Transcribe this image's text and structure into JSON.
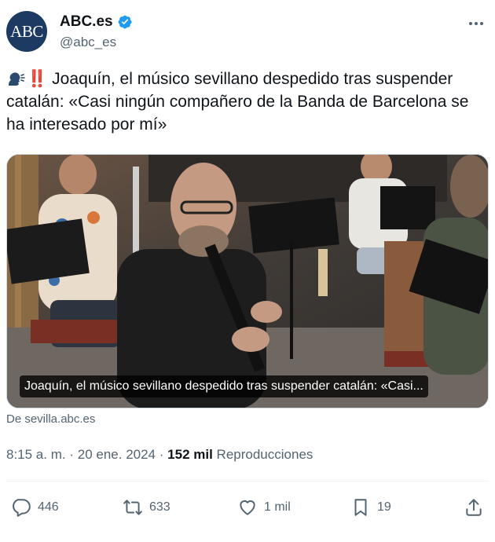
{
  "account": {
    "avatar_text": "ABC",
    "display_name": "ABC.es",
    "handle": "@abc_es",
    "verified": true,
    "avatar_color": "#1d3a63",
    "verified_color": "#1d9bf0"
  },
  "tweet": {
    "emoji_speaking": "speaking-head-emoji",
    "emoji_exclamation": "‼️",
    "text": "Joaquín, el músico sevillano despedido tras suspender catalán: «Casi ningún compañero de la Banda de Barcelona se ha interesado por mí»"
  },
  "media": {
    "caption": "Joaquín, el músico sevillano despedido tras suspender catalán: «Casi...",
    "source": "De sevilla.abc.es"
  },
  "meta": {
    "time": "8:15 a. m.",
    "separator": "·",
    "date": "20 ene. 2024",
    "views_count": "152 mil",
    "views_label": "Reproducciones"
  },
  "actions": {
    "replies": "446",
    "reposts": "633",
    "likes": "1 mil",
    "bookmarks": "19"
  },
  "icons": [
    "more-icon",
    "verified-icon",
    "reply-icon",
    "repost-icon",
    "like-icon",
    "bookmark-icon",
    "share-icon"
  ]
}
